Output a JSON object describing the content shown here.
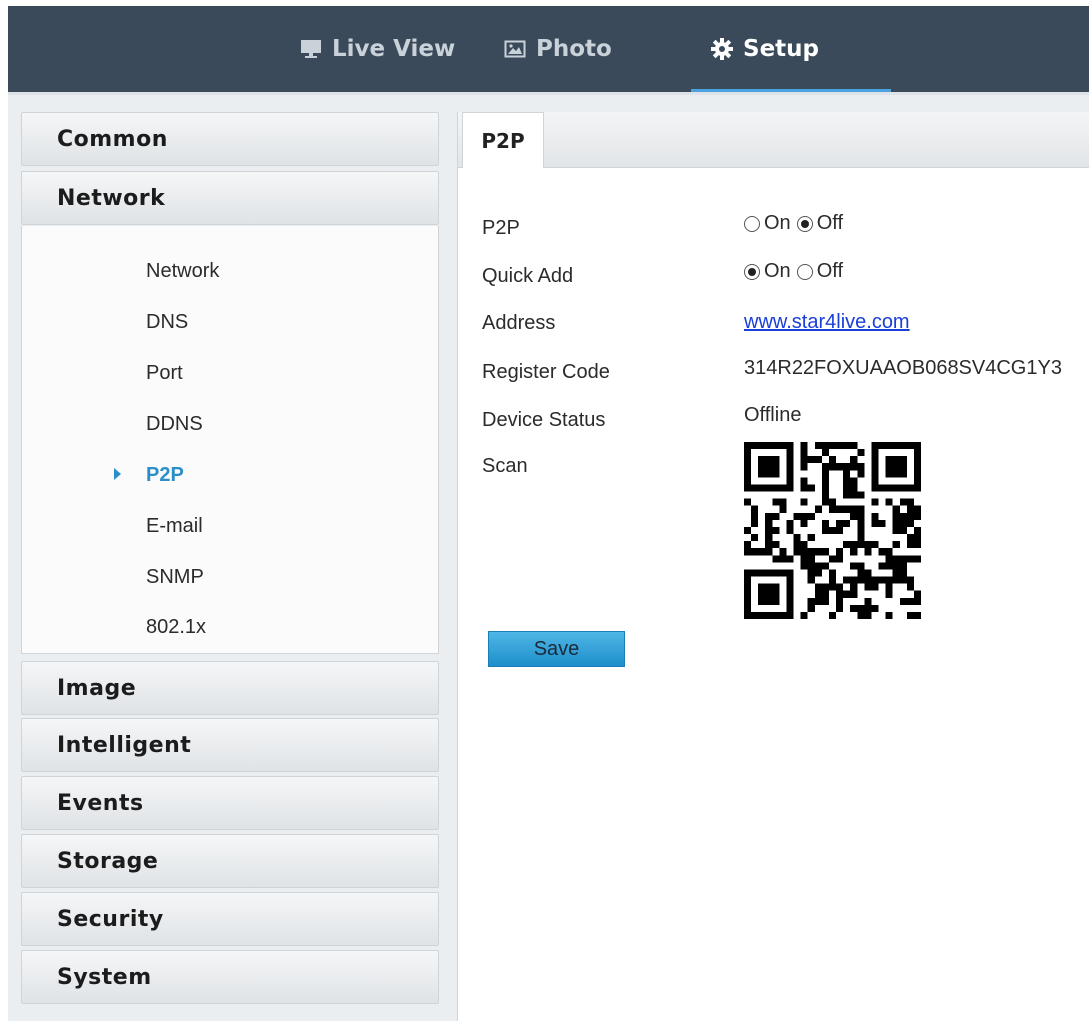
{
  "topnav": {
    "items": [
      {
        "label": "Live View",
        "icon": "monitor-icon"
      },
      {
        "label": "Photo",
        "icon": "image-icon"
      },
      {
        "label": "Setup",
        "icon": "gear-icon"
      }
    ],
    "active": "Setup"
  },
  "sidebar": {
    "sections": [
      "Common",
      "Network",
      "Image",
      "Intelligent",
      "Events",
      "Storage",
      "Security",
      "System"
    ],
    "network_items": [
      "Network",
      "DNS",
      "Port",
      "DDNS",
      "P2P",
      "E-mail",
      "SNMP",
      "802.1x"
    ],
    "active_item": "P2P"
  },
  "content": {
    "tab": "P2P",
    "fields": {
      "p2p": {
        "label": "P2P",
        "on": "On",
        "off": "Off",
        "selected": "Off"
      },
      "quick_add": {
        "label": "Quick Add",
        "on": "On",
        "off": "Off",
        "selected": "On"
      },
      "address": {
        "label": "Address",
        "value": "www.star4live.com"
      },
      "register_code": {
        "label": "Register Code",
        "value": "314R22FOXUAAOB068SV4CG1Y3"
      },
      "device_status": {
        "label": "Device Status",
        "value": "Offline"
      },
      "scan": {
        "label": "Scan",
        "image": "qr-code"
      }
    },
    "save_label": "Save"
  },
  "colors": {
    "topbar": "#3a4a5a",
    "accent": "#2a8fc9",
    "link": "#1a3fd8"
  }
}
